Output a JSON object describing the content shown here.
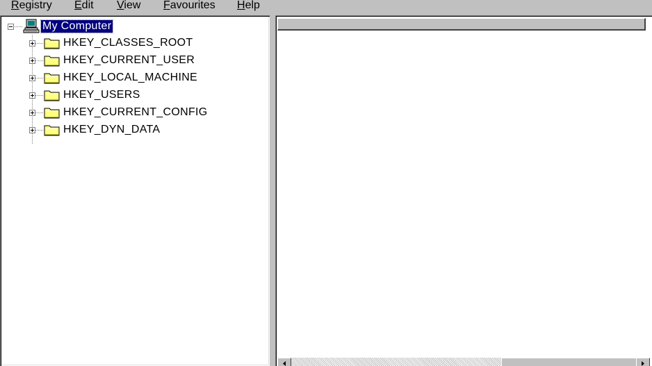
{
  "menu": {
    "registry": {
      "accel": "R",
      "rest": "egistry"
    },
    "edit": {
      "accel": "E",
      "rest": "dit"
    },
    "view": {
      "accel": "V",
      "rest": "iew"
    },
    "favourites": {
      "accel": "F",
      "rest": "avourites"
    },
    "help": {
      "accel": "H",
      "rest": "elp"
    }
  },
  "tree": {
    "root": {
      "label": "My Computer",
      "icon": "computer-icon",
      "expanded": true,
      "selected": true
    },
    "keys": [
      {
        "label": "HKEY_CLASSES_ROOT",
        "icon": "folder-icon"
      },
      {
        "label": "HKEY_CURRENT_USER",
        "icon": "folder-icon"
      },
      {
        "label": "HKEY_LOCAL_MACHINE",
        "icon": "folder-icon"
      },
      {
        "label": "HKEY_USERS",
        "icon": "folder-icon"
      },
      {
        "label": "HKEY_CURRENT_CONFIG",
        "icon": "folder-icon"
      },
      {
        "label": "HKEY_DYN_DATA",
        "icon": "folder-icon"
      }
    ]
  },
  "colors": {
    "selection": "#000080",
    "folder": "#ffff80",
    "face": "#c0c0c0"
  }
}
